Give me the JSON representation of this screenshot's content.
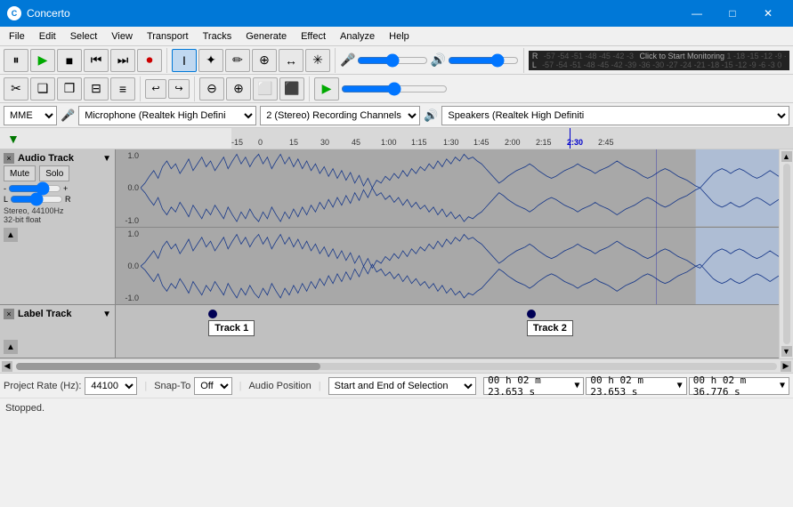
{
  "app": {
    "title": "Concerto",
    "icon": "C"
  },
  "window_controls": {
    "minimize": "—",
    "maximize": "□",
    "close": "✕"
  },
  "menu": {
    "items": [
      "File",
      "Edit",
      "Select",
      "View",
      "Transport",
      "Tracks",
      "Generate",
      "Effect",
      "Analyze",
      "Help"
    ]
  },
  "transport_toolbar": {
    "pause": "⏸",
    "play": "▶",
    "stop": "■",
    "skip_start": "⏮",
    "skip_end": "⏭",
    "record": "⏺"
  },
  "vu_meter": {
    "top_scale": "-57  -54  -51  -48  -45  -42  -3    Click to Start Monitoring  1  -18  -15  -12   -9   -6   -3   0",
    "bottom_scale": "-57  -54  -51  -48  -45  -42  -39  -36  -30  -27  -24  -21  -18  -15  -12   -9   -6   -3   0",
    "r_label": "R",
    "l_label": "L"
  },
  "tools": {
    "select": "I",
    "envelope": "✦",
    "draw": "✏",
    "zoom": "🔍",
    "timeshift": "↔",
    "multi": "*",
    "mic_top": "🎤",
    "mic_bot": "🎤"
  },
  "edit_toolbar": {
    "cut": "✂",
    "copy": "❑",
    "paste": "❒",
    "trim": "|||",
    "silence": "___",
    "undo": "↩",
    "redo": "↪",
    "zoom_out": "🔍-",
    "zoom_in": "🔍+",
    "zoom_sel": "⬜",
    "zoom_fit": "⬛"
  },
  "device_bar": {
    "api": "MME",
    "mic_label": "🎤",
    "microphone": "Microphone (Realtek High Defini",
    "channels": "2 (Stereo) Recording Channels",
    "speaker_label": "🔊",
    "speaker": "Speakers (Realtek High Definiti"
  },
  "timeline": {
    "arrow": "▼",
    "markers": [
      "-15",
      "0",
      "15",
      "30",
      "45",
      "1:00",
      "1:15",
      "1:30",
      "1:45",
      "2:00",
      "2:15",
      "2:30",
      "2:45"
    ],
    "playhead_pos": "2:30"
  },
  "audio_track": {
    "close": "×",
    "name": "Audio Track",
    "menu_arrow": "▼",
    "mute": "Mute",
    "solo": "Solo",
    "vol_minus": "-",
    "vol_plus": "+",
    "pan_l": "L",
    "pan_r": "R",
    "info": "Stereo, 44100Hz\n32-bit float",
    "collapse": "▲",
    "scale_top": "1.0",
    "scale_mid": "0.0",
    "scale_bot": "-1.0",
    "scale2_top": "1.0",
    "scale2_mid": "0.0",
    "scale2_bot": "-1.0"
  },
  "label_track": {
    "close": "×",
    "name": "Label Track",
    "menu_arrow": "▼",
    "collapse": "▲",
    "label1": "Track 1",
    "label2": "Track 2",
    "label1_pos": "14%",
    "label2_pos": "62%"
  },
  "status_bar": {
    "project_rate_label": "Project Rate (Hz):",
    "project_rate": "44100",
    "snap_to_label": "Snap-To",
    "snap_to": "Off",
    "audio_position_label": "Audio Position",
    "position_mode": "Start and End of Selection",
    "pos1": "0 0 h 0 2 m 2 3 . 6 5 3 s",
    "pos2": "0 0 h 0 2 m 2 3 . 6 5 3 s",
    "pos3": "0 0 h 0 2 m 3 6 . 7 7 6 s",
    "status": "Stopped."
  }
}
